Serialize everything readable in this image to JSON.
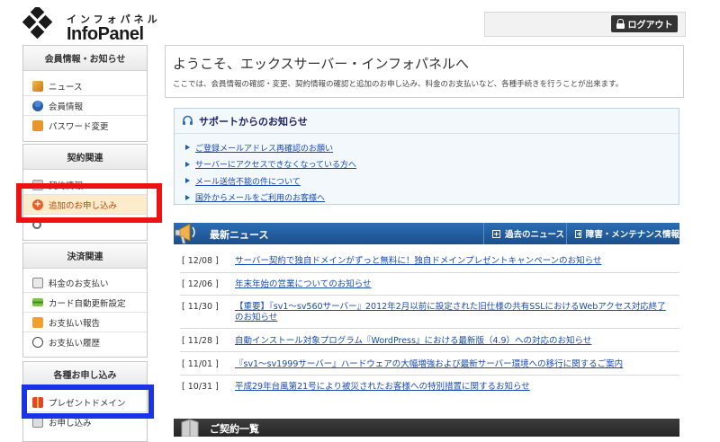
{
  "header": {
    "logo_kana": "インフォパネル",
    "logo_name": "InfoPanel",
    "logout_label": "ログアウト"
  },
  "sidebar": {
    "member": {
      "title": "会員情報・お知らせ",
      "items": [
        {
          "label": "ニュース",
          "icon": "megaphone-icon"
        },
        {
          "label": "会員情報",
          "icon": "user-icon"
        },
        {
          "label": "パスワード変更",
          "icon": "bag-lock-icon"
        }
      ]
    },
    "contract": {
      "title": "契約関連",
      "items": [
        {
          "label": "契約情報",
          "icon": "document-icon"
        },
        {
          "label": "追加のお申し込み",
          "icon": "plus-circle-icon",
          "active": true
        },
        {
          "label": "",
          "icon": "search-icon"
        }
      ]
    },
    "payment": {
      "title": "決済関連",
      "items": [
        {
          "label": "料金のお支払い",
          "icon": "invoice-icon"
        },
        {
          "label": "カード自動更新設定",
          "icon": "credit-card-icon"
        },
        {
          "label": "お支払い報告",
          "icon": "speech-bubble-icon"
        },
        {
          "label": "お支払い履歴",
          "icon": "clock-icon"
        }
      ]
    },
    "applications": {
      "title": "各種お申し込み",
      "items": [
        {
          "label": "プレゼントドメイン",
          "icon": "gift-icon"
        },
        {
          "label": "お申し込み",
          "icon": "form-icon"
        }
      ]
    }
  },
  "welcome": {
    "title": "ようこそ、エックスサーバー・インフォパネルへ",
    "description": "ここでは、会員情報の確認・変更、契約情報の確認と追加のお申し込み、料金のお支払いなど、各種手続きを行うことが出来ます。"
  },
  "support": {
    "title": "サポートからのお知らせ",
    "items": [
      "ご登録メールアドレス再確認のお願い",
      "サーバーにアクセスできなくなっている方へ",
      "メール送信不能の件について",
      "国外からメールをご利用のお客様へ"
    ]
  },
  "news": {
    "title": "最新ニュース",
    "past_news_label": "過去のニュース",
    "maintenance_label": "障害・メンテナンス情報",
    "items": [
      {
        "date": "[ 12/08 ]",
        "text": "サーバー契約で独自ドメインがずっと無料に！独自ドメインプレゼントキャンペーンのお知らせ"
      },
      {
        "date": "[ 12/06 ]",
        "text": "年末年始の営業についてのお知らせ"
      },
      {
        "date": "[ 11/30 ]",
        "text": "【重要】『sv1～sv560サーバー』2012年2月以前に設定された旧仕様の共有SSLにおけるWebアクセス対応終了のお知らせ"
      },
      {
        "date": "[ 11/28 ]",
        "text": "自動インストール対象プログラム『WordPress』における最新版（4.9）への対応のお知らせ"
      },
      {
        "date": "[ 11/01 ]",
        "text": "『sv1～sv1999サーバー』ハードウェアの大幅増強および最新サーバー環境への移行に関するご案内"
      },
      {
        "date": "[ 10/31 ]",
        "text": "平成29年台風第21号により被災されたお客様への特別措置に関するお知らせ"
      }
    ]
  },
  "contract_section": {
    "title": "ご契約一覧"
  },
  "colors": {
    "highlight_red": "#ee1111",
    "highlight_blue": "#1a33e6",
    "news_bar": "#2c6db4",
    "link": "#1a4bb3",
    "active_item_bg": "#fdeccc"
  }
}
